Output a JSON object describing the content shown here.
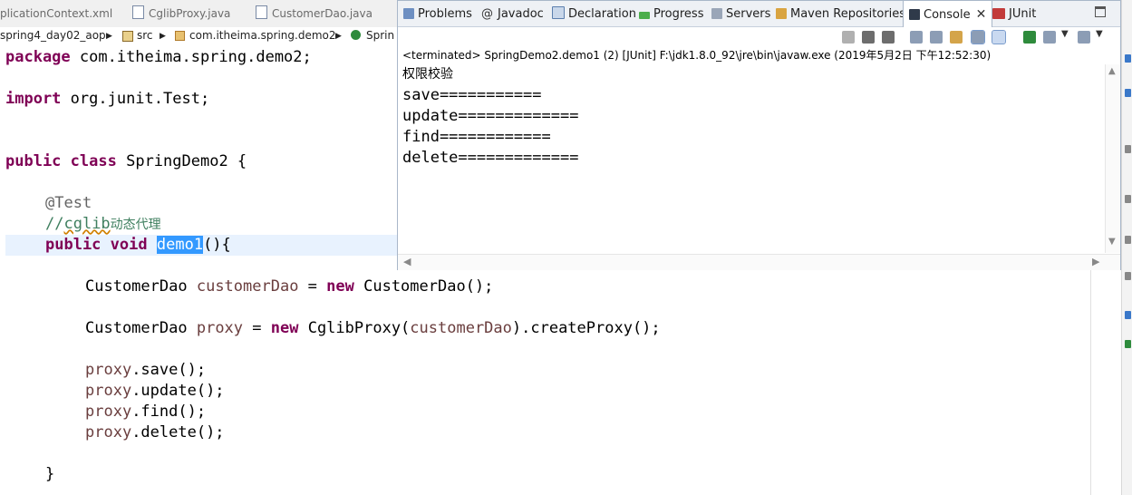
{
  "editor_tabs": [
    "plicationContext.xml",
    "CglibProxy.java",
    "CustomerDao.java"
  ],
  "breadcrumb": {
    "project": "spring4_day02_aop",
    "src": "src",
    "package": "com.itheima.spring.demo2",
    "class": "Sprin"
  },
  "code": {
    "package_kw": "package",
    "package_name": " com.itheima.spring.demo2;",
    "import_kw": "import",
    "import_name": " org.junit.Test;",
    "public_kw": "public",
    "class_kw": "class",
    "class_name": " SpringDemo2 {",
    "annotation": "@Test",
    "comment_prefix": "//",
    "comment_cglib": "cglib",
    "comment_cn": "动态代理",
    "void_kw": "void",
    "method_name": "demo1",
    "method_rest": "(){",
    "line1_type": "CustomerDao",
    "line1_var": "customerDao",
    "line1_eq": " = ",
    "new_kw": "new",
    "line1_rest": " CustomerDao();",
    "line2_type": "CustomerDao",
    "line2_var": "proxy",
    "line2_eq": " = ",
    "line2_mid": " CglibProxy(",
    "line2_arg": "customerDao",
    "line2_end": ").createProxy();",
    "proxy_var": "proxy",
    "call_save": ".save();",
    "call_update": ".update();",
    "call_find": ".find();",
    "call_delete": ".delete();",
    "close_brace": "}"
  },
  "views": {
    "tabs": [
      {
        "label": "Problems"
      },
      {
        "label": "Javadoc"
      },
      {
        "label": "Declaration"
      },
      {
        "label": "Progress"
      },
      {
        "label": "Servers"
      },
      {
        "label": "Maven Repositories"
      },
      {
        "label": "Console",
        "close": "✕"
      },
      {
        "label": "JUnit"
      }
    ],
    "console_status": "<terminated> SpringDemo2.demo1 (2) [JUnit] F:\\jdk1.8.0_92\\jre\\bin\\javaw.exe (2019年5月2日 下午12:52:30)",
    "console_output": [
      "权限校验",
      "save===========",
      "update=============",
      "find============",
      "delete============="
    ]
  },
  "colors": {
    "keyword": "#7f0055",
    "comment": "#3f7f5f",
    "annotation": "#646464",
    "field": "#6a3e3e",
    "selection": "#3399ff"
  }
}
